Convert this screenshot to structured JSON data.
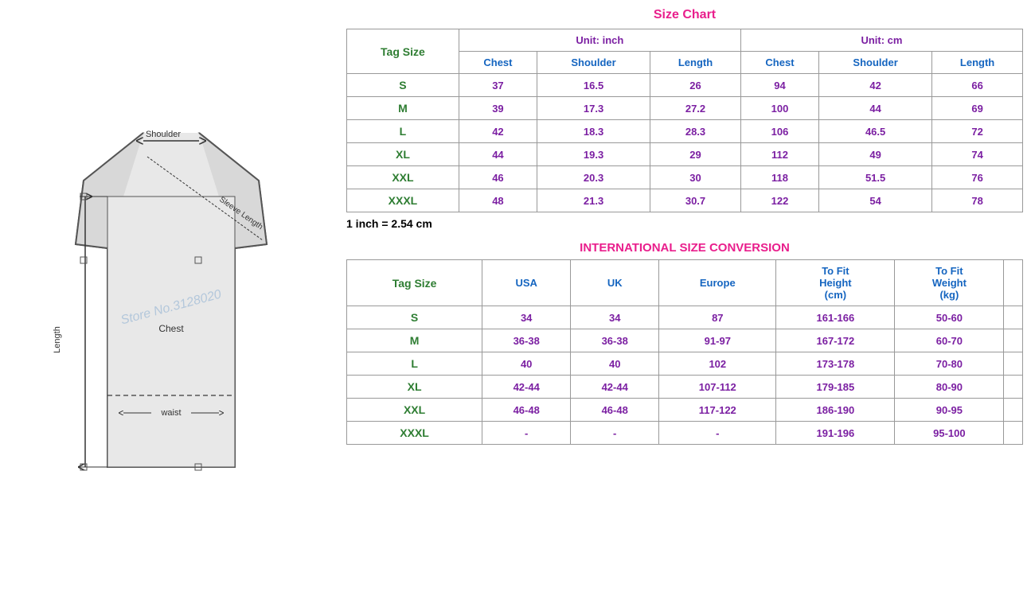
{
  "left": {
    "diagram_alt": "T-shirt size diagram with measurements"
  },
  "size_chart": {
    "title": "Size Chart",
    "unit_inch": "Unit: inch",
    "unit_cm": "Unit: cm",
    "tag_size_label": "Tag Size",
    "inch_columns": [
      "Chest",
      "Shoulder",
      "Length"
    ],
    "cm_columns": [
      "Chest",
      "Shoulder",
      "Length"
    ],
    "rows": [
      {
        "tag": "S",
        "inch_chest": "37",
        "inch_shoulder": "16.5",
        "inch_length": "26",
        "cm_chest": "94",
        "cm_shoulder": "42",
        "cm_length": "66"
      },
      {
        "tag": "M",
        "inch_chest": "39",
        "inch_shoulder": "17.3",
        "inch_length": "27.2",
        "cm_chest": "100",
        "cm_shoulder": "44",
        "cm_length": "69"
      },
      {
        "tag": "L",
        "inch_chest": "42",
        "inch_shoulder": "18.3",
        "inch_length": "28.3",
        "cm_chest": "106",
        "cm_shoulder": "46.5",
        "cm_length": "72"
      },
      {
        "tag": "XL",
        "inch_chest": "44",
        "inch_shoulder": "19.3",
        "inch_length": "29",
        "cm_chest": "112",
        "cm_shoulder": "49",
        "cm_length": "74"
      },
      {
        "tag": "XXL",
        "inch_chest": "46",
        "inch_shoulder": "20.3",
        "inch_length": "30",
        "cm_chest": "118",
        "cm_shoulder": "51.5",
        "cm_length": "76"
      },
      {
        "tag": "XXXL",
        "inch_chest": "48",
        "inch_shoulder": "21.3",
        "inch_length": "30.7",
        "cm_chest": "122",
        "cm_shoulder": "54",
        "cm_length": "78"
      }
    ],
    "conversion_note": "1 inch = 2.54 cm"
  },
  "international": {
    "title": "INTERNATIONAL SIZE CONVERSION",
    "tag_size_label": "Tag Size",
    "columns": [
      "USA",
      "UK",
      "Europe",
      "To Fit Height (cm)",
      "To Fit Weight (kg)"
    ],
    "rows": [
      {
        "tag": "S",
        "usa": "34",
        "uk": "34",
        "europe": "87",
        "height": "161-166",
        "weight": "50-60"
      },
      {
        "tag": "M",
        "usa": "36-38",
        "uk": "36-38",
        "europe": "91-97",
        "height": "167-172",
        "weight": "60-70"
      },
      {
        "tag": "L",
        "usa": "40",
        "uk": "40",
        "europe": "102",
        "height": "173-178",
        "weight": "70-80"
      },
      {
        "tag": "XL",
        "usa": "42-44",
        "uk": "42-44",
        "europe": "107-112",
        "height": "179-185",
        "weight": "80-90"
      },
      {
        "tag": "XXL",
        "usa": "46-48",
        "uk": "46-48",
        "europe": "117-122",
        "height": "186-190",
        "weight": "90-95"
      },
      {
        "tag": "XXXL",
        "usa": "-",
        "uk": "-",
        "europe": "-",
        "height": "191-196",
        "weight": "95-100"
      }
    ]
  },
  "watermark": "Store No.3128020"
}
